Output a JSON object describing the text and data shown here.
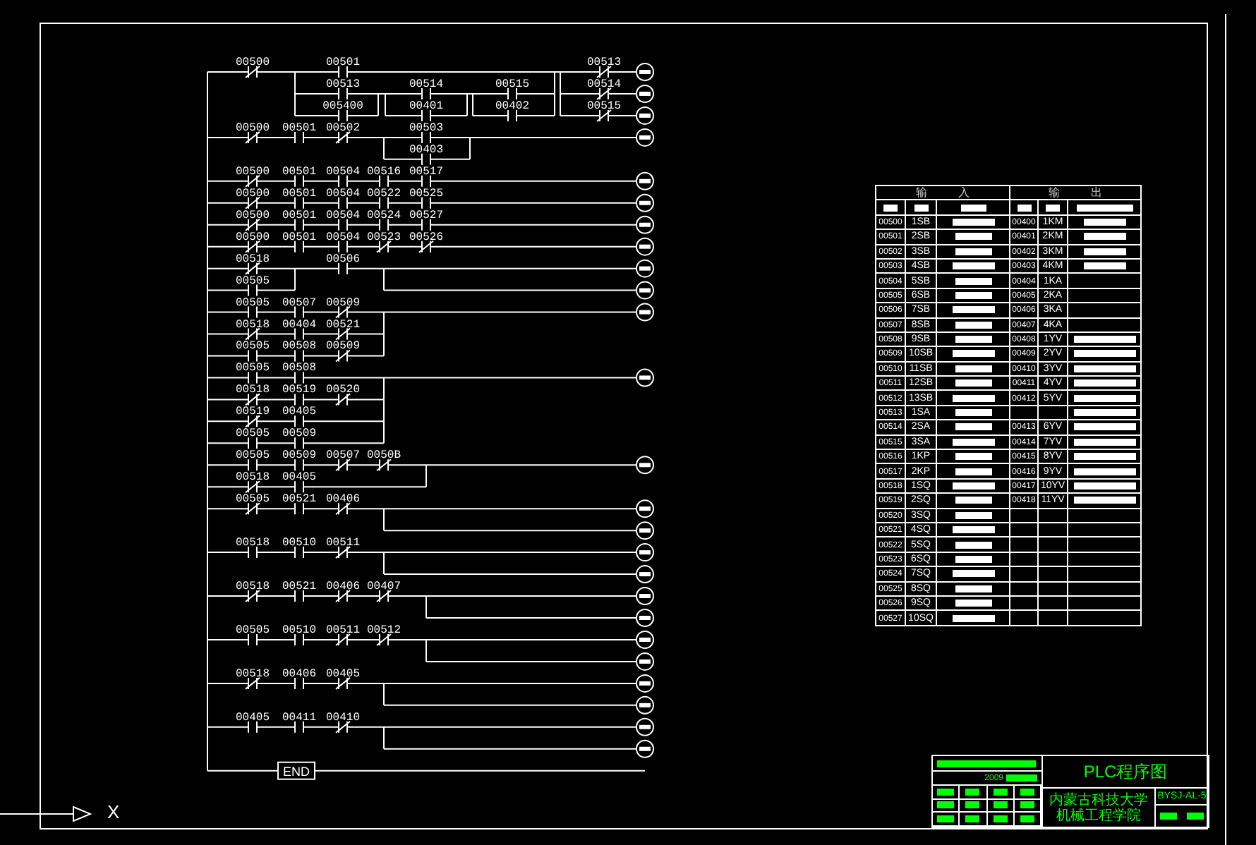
{
  "ladder": {
    "lines": [
      {
        "coil": true,
        "contacts": [
          {
            "label": "00500",
            "kind": "nc"
          },
          {
            "label": "00501",
            "kind": "no"
          },
          {
            "label": "00513",
            "kind": "nc"
          }
        ]
      },
      {
        "coil": true,
        "contacts": [
          {
            "label": "00513",
            "kind": "no"
          },
          {
            "label": "00514",
            "kind": "no"
          },
          {
            "label": "00515",
            "kind": "no"
          },
          {
            "label": "00514",
            "kind": "nc"
          }
        ]
      },
      {
        "coil": true,
        "contacts": [
          {
            "label": "005400",
            "kind": "no"
          },
          {
            "label": "00401",
            "kind": "no"
          },
          {
            "label": "00402",
            "kind": "no"
          },
          {
            "label": "00515",
            "kind": "nc"
          }
        ]
      },
      {
        "coil": true,
        "contacts": [
          {
            "label": "00500",
            "kind": "nc"
          },
          {
            "label": "00501",
            "kind": "no"
          },
          {
            "label": "00502",
            "kind": "nc"
          },
          {
            "label": "00503",
            "kind": "no"
          }
        ]
      },
      {
        "coil": false,
        "contacts": [
          {
            "label": "00403",
            "kind": "no"
          }
        ]
      },
      {
        "coil": true,
        "contacts": [
          {
            "label": "00500",
            "kind": "nc"
          },
          {
            "label": "00501",
            "kind": "no"
          },
          {
            "label": "00504",
            "kind": "no"
          },
          {
            "label": "00516",
            "kind": "no"
          },
          {
            "label": "00517",
            "kind": "no"
          }
        ]
      },
      {
        "coil": true,
        "contacts": [
          {
            "label": "00500",
            "kind": "nc"
          },
          {
            "label": "00501",
            "kind": "no"
          },
          {
            "label": "00504",
            "kind": "no"
          },
          {
            "label": "00522",
            "kind": "no"
          },
          {
            "label": "00525",
            "kind": "no"
          }
        ]
      },
      {
        "coil": true,
        "contacts": [
          {
            "label": "00500",
            "kind": "nc"
          },
          {
            "label": "00501",
            "kind": "no"
          },
          {
            "label": "00504",
            "kind": "no"
          },
          {
            "label": "00524",
            "kind": "no"
          },
          {
            "label": "00527",
            "kind": "no"
          }
        ]
      },
      {
        "coil": true,
        "contacts": [
          {
            "label": "00500",
            "kind": "nc"
          },
          {
            "label": "00501",
            "kind": "no"
          },
          {
            "label": "00504",
            "kind": "no"
          },
          {
            "label": "00523",
            "kind": "nc"
          },
          {
            "label": "00526",
            "kind": "nc"
          }
        ]
      },
      {
        "coil": true,
        "contacts": [
          {
            "label": "00518",
            "kind": "nc"
          },
          {
            "label": "00506",
            "kind": "no"
          }
        ]
      },
      {
        "coil": true,
        "contacts": [
          {
            "label": "00505",
            "kind": "no"
          }
        ]
      },
      {
        "coil": true,
        "contacts": [
          {
            "label": "00505",
            "kind": "no"
          },
          {
            "label": "00507",
            "kind": "no"
          },
          {
            "label": "00509",
            "kind": "nc"
          }
        ]
      },
      {
        "coil": false,
        "contacts": [
          {
            "label": "00518",
            "kind": "nc"
          },
          {
            "label": "00404",
            "kind": "no"
          },
          {
            "label": "00521",
            "kind": "nc"
          }
        ]
      },
      {
        "coil": false,
        "contacts": [
          {
            "label": "00505",
            "kind": "no"
          },
          {
            "label": "00508",
            "kind": "no"
          },
          {
            "label": "00509",
            "kind": "nc"
          }
        ]
      },
      {
        "coil": true,
        "contacts": [
          {
            "label": "00505",
            "kind": "no"
          },
          {
            "label": "00508",
            "kind": "no"
          }
        ]
      },
      {
        "coil": false,
        "contacts": [
          {
            "label": "00518",
            "kind": "nc"
          },
          {
            "label": "00519",
            "kind": "no"
          },
          {
            "label": "00520",
            "kind": "nc"
          }
        ]
      },
      {
        "coil": false,
        "contacts": [
          {
            "label": "00519",
            "kind": "nc"
          },
          {
            "label": "00405",
            "kind": "no"
          }
        ]
      },
      {
        "coil": false,
        "contacts": [
          {
            "label": "00505",
            "kind": "no"
          },
          {
            "label": "00509",
            "kind": "no"
          }
        ]
      },
      {
        "coil": true,
        "contacts": [
          {
            "label": "00505",
            "kind": "no"
          },
          {
            "label": "00509",
            "kind": "no"
          },
          {
            "label": "00507",
            "kind": "nc"
          },
          {
            "label": "0050B",
            "kind": "nc"
          }
        ]
      },
      {
        "coil": false,
        "contacts": [
          {
            "label": "00518",
            "kind": "nc"
          },
          {
            "label": "00405",
            "kind": "no"
          }
        ]
      },
      {
        "coil": true,
        "contacts": [
          {
            "label": "00505",
            "kind": "nc"
          },
          {
            "label": "00521",
            "kind": "no"
          },
          {
            "label": "00406",
            "kind": "nc"
          }
        ]
      },
      {
        "coil": true
      },
      {
        "coil": true,
        "contacts": [
          {
            "label": "00518",
            "kind": "no"
          },
          {
            "label": "00510",
            "kind": "no"
          },
          {
            "label": "00511",
            "kind": "nc"
          }
        ]
      },
      {
        "coil": true
      },
      {
        "coil": true,
        "contacts": [
          {
            "label": "00518",
            "kind": "nc"
          },
          {
            "label": "00521",
            "kind": "no"
          },
          {
            "label": "00406",
            "kind": "nc"
          },
          {
            "label": "00407",
            "kind": "nc"
          }
        ]
      },
      {
        "coil": true
      },
      {
        "coil": true,
        "contacts": [
          {
            "label": "00505",
            "kind": "no"
          },
          {
            "label": "00510",
            "kind": "no"
          },
          {
            "label": "00511",
            "kind": "nc"
          },
          {
            "label": "00512",
            "kind": "nc"
          }
        ]
      },
      {
        "coil": true
      },
      {
        "coil": true,
        "contacts": [
          {
            "label": "00518",
            "kind": "nc"
          },
          {
            "label": "00406",
            "kind": "no"
          },
          {
            "label": "00405",
            "kind": "nc"
          }
        ]
      },
      {
        "coil": true
      },
      {
        "coil": true,
        "contacts": [
          {
            "label": "00405",
            "kind": "no"
          },
          {
            "label": "00411",
            "kind": "no"
          },
          {
            "label": "00410",
            "kind": "nc"
          }
        ]
      },
      {
        "coil": true
      }
    ],
    "end_label": "END"
  },
  "io_table": {
    "header": {
      "input": [
        "输",
        "入"
      ],
      "output": [
        "输",
        "出"
      ]
    },
    "rows": [
      {
        "in_addr": "00500",
        "in_name": "1SB",
        "out_addr": "00400",
        "out_name": "1KM",
        "out_note": true
      },
      {
        "in_addr": "00501",
        "in_name": "2SB",
        "out_addr": "00401",
        "out_name": "2KM",
        "out_note": true
      },
      {
        "in_addr": "00502",
        "in_name": "3SB",
        "out_addr": "00402",
        "out_name": "3KM",
        "out_note": true
      },
      {
        "in_addr": "00503",
        "in_name": "4SB",
        "out_addr": "00403",
        "out_name": "4KM",
        "out_note": true
      },
      {
        "in_addr": "00504",
        "in_name": "5SB",
        "out_addr": "00404",
        "out_name": "1KA",
        "out_note": false
      },
      {
        "in_addr": "00505",
        "in_name": "6SB",
        "out_addr": "00405",
        "out_name": "2KA",
        "out_note": false
      },
      {
        "in_addr": "00506",
        "in_name": "7SB",
        "out_addr": "00406",
        "out_name": "3KA",
        "out_note": false
      },
      {
        "in_addr": "00507",
        "in_name": "8SB",
        "out_addr": "00407",
        "out_name": "4KA",
        "out_note": false
      },
      {
        "in_addr": "00508",
        "in_name": "9SB",
        "out_addr": "00408",
        "out_name": "1YV",
        "out_note": true
      },
      {
        "in_addr": "00509",
        "in_name": "10SB",
        "out_addr": "00409",
        "out_name": "2YV",
        "out_note": true
      },
      {
        "in_addr": "00510",
        "in_name": "11SB",
        "out_addr": "00410",
        "out_name": "3YV",
        "out_note": true
      },
      {
        "in_addr": "00511",
        "in_name": "12SB",
        "out_addr": "00411",
        "out_name": "4YV",
        "out_note": true
      },
      {
        "in_addr": "00512",
        "in_name": "13SB",
        "out_addr": "00412",
        "out_name": "5YV",
        "out_note": true
      },
      {
        "in_addr": "00513",
        "in_name": "1SA",
        "out_note": true
      },
      {
        "in_addr": "00514",
        "in_name": "2SA",
        "out_addr": "00413",
        "out_name": "6YV",
        "out_note": true
      },
      {
        "in_addr": "00515",
        "in_name": "3SA",
        "out_addr": "00414",
        "out_name": "7YV",
        "out_note": true
      },
      {
        "in_addr": "00516",
        "in_name": "1KP",
        "out_addr": "00415",
        "out_name": "8YV",
        "out_note": true
      },
      {
        "in_addr": "00517",
        "in_name": "2KP",
        "out_addr": "00416",
        "out_name": "9YV",
        "out_note": true
      },
      {
        "in_addr": "00518",
        "in_name": "1SQ",
        "out_addr": "00417",
        "out_name": "10YV",
        "out_note": true
      },
      {
        "in_addr": "00519",
        "in_name": "2SQ",
        "out_addr": "00418",
        "out_name": "11YV",
        "out_note": true
      },
      {
        "in_addr": "00520",
        "in_name": "3SQ",
        "out_note": false
      },
      {
        "in_addr": "00521",
        "in_name": "4SQ",
        "out_note": false
      },
      {
        "in_addr": "00522",
        "in_name": "5SQ",
        "out_note": false
      },
      {
        "in_addr": "00523",
        "in_name": "6SQ",
        "out_note": false
      },
      {
        "in_addr": "00524",
        "in_name": "7SQ",
        "out_note": false
      },
      {
        "in_addr": "00525",
        "in_name": "8SQ",
        "out_note": false
      },
      {
        "in_addr": "00526",
        "in_name": "9SQ",
        "out_note": false
      },
      {
        "in_addr": "00527",
        "in_name": "10SQ",
        "out_note": false
      }
    ]
  },
  "title_block": {
    "date": "2009",
    "title": "PLC程序图",
    "school": "内蒙古科技大学",
    "department": "机械工程学院",
    "drawing_no": "BYSJ-AL-5"
  },
  "ucs": {
    "x_label": "X"
  }
}
